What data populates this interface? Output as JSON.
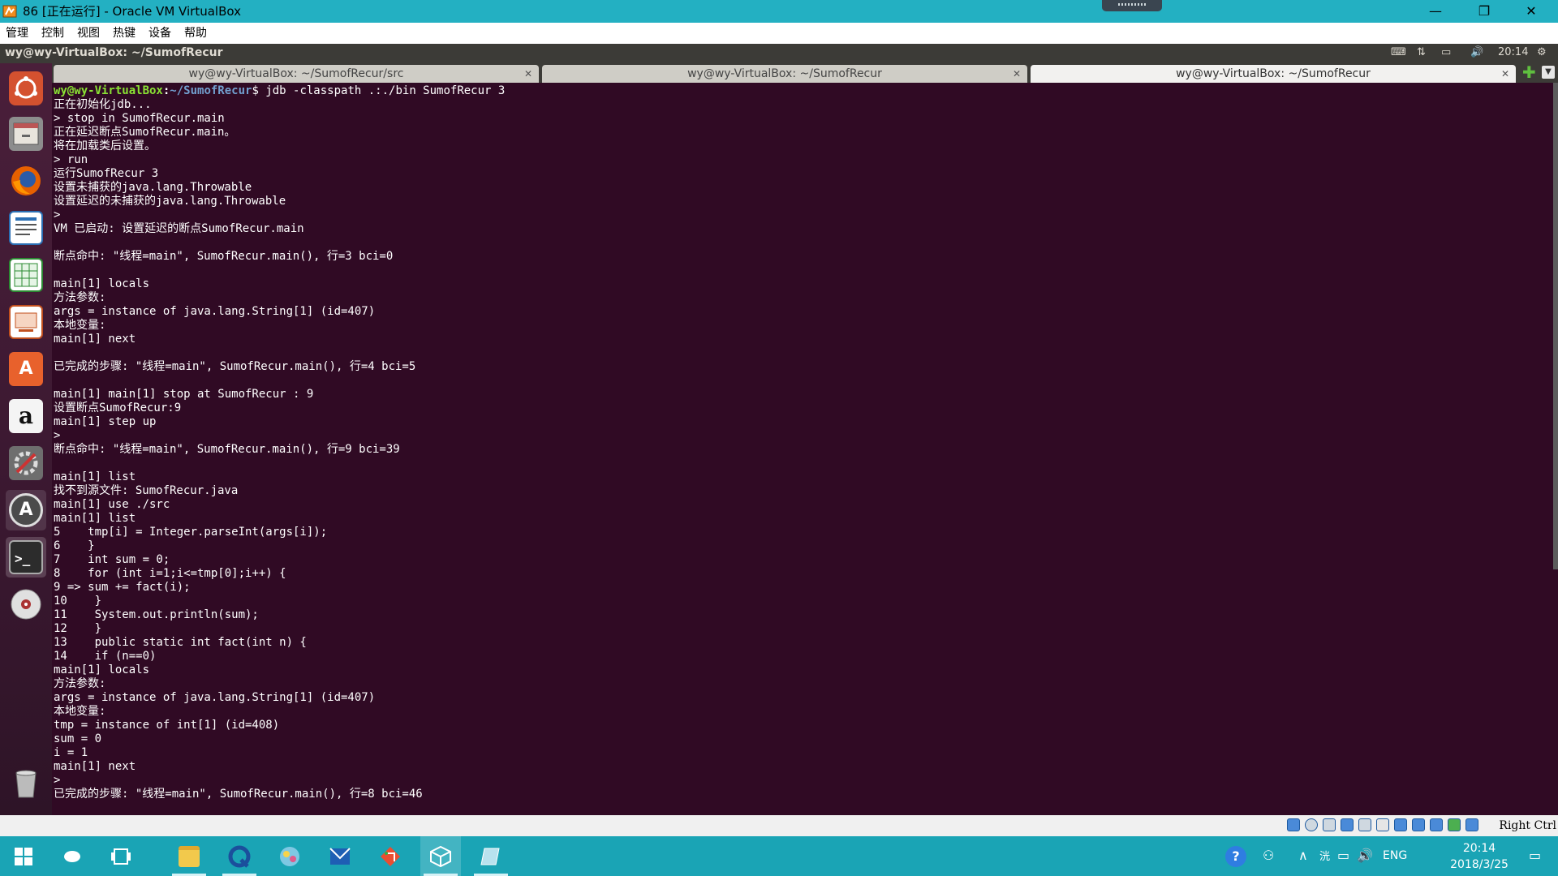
{
  "window": {
    "title": "86 [正在运行] - Oracle VM VirtualBox",
    "controls": [
      "—",
      "❐",
      "✕"
    ]
  },
  "menu": [
    "管理",
    "控制",
    "视图",
    "热键",
    "设备",
    "帮助"
  ],
  "guest_topbar": {
    "title": "wy@wy-VirtualBox: ~/SumofRecur",
    "time": "20:14"
  },
  "tabs": [
    {
      "label": "wy@wy-VirtualBox: ~/SumofRecur/src",
      "active": false
    },
    {
      "label": "wy@wy-VirtualBox: ~/SumofRecur",
      "active": false
    },
    {
      "label": "wy@wy-VirtualBox: ~/SumofRecur",
      "active": true
    }
  ],
  "launcher": [
    "ubuntu-dash-icon",
    "files-icon",
    "firefox-icon",
    "writer-icon",
    "calc-icon",
    "impress-icon",
    "software-center-icon",
    "amazon-icon",
    "settings-icon",
    "software-updater-icon",
    "terminal-icon",
    "dvd-icon",
    "trash-icon"
  ],
  "terminal": {
    "prompt_user": "wy@wy-VirtualBox",
    "prompt_path": "~/SumofRecur",
    "prompt_cmd": "$ jdb -classpath .:./bin SumofRecur 3",
    "lines": [
      "正在初始化jdb...",
      "> stop in SumofRecur.main",
      "正在延迟断点SumofRecur.main。",
      "将在加载类后设置。",
      "> run",
      "运行SumofRecur 3",
      "设置未捕获的java.lang.Throwable",
      "设置延迟的未捕获的java.lang.Throwable",
      ">",
      "VM 已启动: 设置延迟的断点SumofRecur.main",
      "",
      "断点命中: \"线程=main\", SumofRecur.main(), 行=3 bci=0",
      "",
      "main[1] locals",
      "方法参数:",
      "args = instance of java.lang.String[1] (id=407)",
      "本地变量:",
      "main[1] next",
      "",
      "已完成的步骤: \"线程=main\", SumofRecur.main(), 行=4 bci=5",
      "",
      "main[1] main[1] stop at SumofRecur : 9",
      "设置断点SumofRecur:9",
      "main[1] step up",
      ">",
      "断点命中: \"线程=main\", SumofRecur.main(), 行=9 bci=39",
      "",
      "main[1] list",
      "找不到源文件: SumofRecur.java",
      "main[1] use ./src",
      "main[1] list",
      "5    tmp[i] = Integer.parseInt(args[i]);",
      "6    }",
      "7    int sum = 0;",
      "8    for (int i=1;i<=tmp[0];i++) {",
      "9 => sum += fact(i);",
      "10    }",
      "11    System.out.println(sum);",
      "12    }",
      "13    public static int fact(int n) {",
      "14    if (n==0)",
      "main[1] locals",
      "方法参数:",
      "args = instance of java.lang.String[1] (id=407)",
      "本地变量:",
      "tmp = instance of int[1] (id=408)",
      "sum = 0",
      "i = 1",
      "main[1] next",
      ">",
      "已完成的步骤: \"线程=main\", SumofRecur.main(), 行=8 bci=46"
    ]
  },
  "vbox_status": {
    "hostkey": "Right Ctrl"
  },
  "taskbar": {
    "apps": [
      "start-icon",
      "cortana-icon",
      "task-view-icon",
      "file-explorer-icon",
      "browser-icon",
      "app-icon",
      "mail-icon",
      "git-icon",
      "virtualbox-icon",
      "notepad-icon"
    ],
    "lang": "ENG",
    "time": "20:14",
    "date": "2018/3/25"
  },
  "colors": {
    "taskbar": "#1aa4b5",
    "terminal_bg": "#300a24",
    "prompt_user": "#8ae234",
    "prompt_path": "#729fcf"
  }
}
